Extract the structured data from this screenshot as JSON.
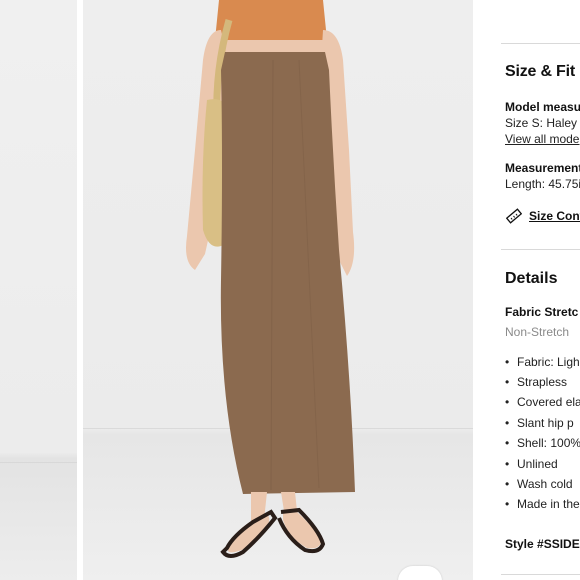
{
  "product_panel": {
    "size_fit": {
      "heading": "Size & Fit",
      "model_label": "Model measu",
      "model_size_text": "Size S: Haley",
      "view_models_link": "View all mode",
      "measurement_label": "Measurement",
      "length_text": "Length: 45.75i",
      "size_conversion_link": "Size Conv"
    },
    "details": {
      "heading": "Details",
      "fabric_stretch_label": "Fabric Stretc",
      "fabric_stretch_value": "Non-Stretch",
      "bullets": [
        "Fabric: Ligh",
        "Strapless",
        "Covered ela",
        "Slant hip p",
        "Shell: 100%",
        "Unlined",
        "Wash cold",
        "Made in the"
      ],
      "style_label": "Style #SSIDE"
    }
  },
  "colors": {
    "dress": "#8b6a4f",
    "bag": "#d9bf85",
    "hair": "#d98a4f",
    "skin": "#ebc7ae",
    "sandal": "#2a1e19"
  }
}
